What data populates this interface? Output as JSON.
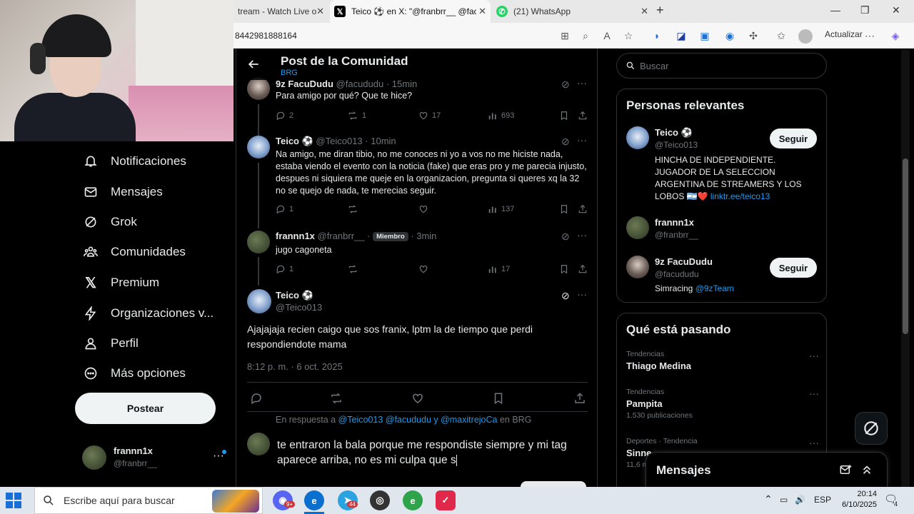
{
  "browser": {
    "tabs": [
      {
        "label": "tream - Watch Live o",
        "active": false
      },
      {
        "label": "Teico ⚽ en X: \"@franbrr__ @facu",
        "active": true
      },
      {
        "label": "(21) WhatsApp",
        "active": false
      }
    ],
    "new_tab": "+",
    "url": "8442981888164",
    "update_label": "Actualizar"
  },
  "nav": {
    "items": [
      {
        "label": "Notificaciones",
        "icon": "bell-icon"
      },
      {
        "label": "Mensajes",
        "icon": "mail-icon"
      },
      {
        "label": "Grok",
        "icon": "grok-icon"
      },
      {
        "label": "Comunidades",
        "icon": "communities-icon"
      },
      {
        "label": "Premium",
        "icon": "x-logo-icon"
      },
      {
        "label": "Organizaciones v...",
        "icon": "lightning-icon"
      },
      {
        "label": "Perfil",
        "icon": "person-icon"
      },
      {
        "label": "Más opciones",
        "icon": "more-circle-icon"
      }
    ],
    "post_button": "Postear",
    "me": {
      "name": "frannn1x",
      "handle": "@franbrr__"
    }
  },
  "main": {
    "title": "Post de la Comunidad",
    "subtitle": "BRG",
    "replies": [
      {
        "name": "9z FacuDudu",
        "handle": "@facududu",
        "time": "· 15min",
        "text": "Para amigo por qué? Que te hice?",
        "replies": "2",
        "reposts": "1",
        "likes": "17",
        "views": "693"
      },
      {
        "name": "Teico ⚽",
        "handle": "@Teico013",
        "time": "· 10min",
        "text": "Na amigo, me diran tibio, no me conoces ni yo a vos no me hiciste nada, estaba viendo el evento con la noticia (fake) que eras pro y me parecia injusto, despues ni siquiera me queje en la organizacion, pregunta si queres xq la 32 no se quejo de nada, te merecias seguir.",
        "replies": "1",
        "reposts": "",
        "likes": "",
        "views": "137"
      },
      {
        "name": "frannn1x",
        "handle": "@franbrr__",
        "badge": "Miembro",
        "time": "· 3min",
        "text": "jugo cagoneta",
        "replies": "1",
        "reposts": "",
        "likes": "",
        "views": "17"
      }
    ],
    "focused": {
      "name": "Teico ⚽",
      "handle": "@Teico013",
      "text": "Ajajajaja recien caigo que sos franix, lptm la de tiempo que perdi respondiendote mama",
      "timestamp": "8:12 p. m. · 6 oct. 2025"
    },
    "reply_context": {
      "prefix": "En respuesta a",
      "mentions": "@Teico013 @facududu y @maxitrejoCa",
      "suffix": "en BRG"
    },
    "composer_text": "te entraron la bala porque me respondiste siempre y mi tag aparece arriba, no es mi culpa que s"
  },
  "right": {
    "search_placeholder": "Buscar",
    "relevant": {
      "title": "Personas relevantes",
      "people": [
        {
          "name": "Teico ⚽",
          "handle": "@Teico013",
          "bio": "HINCHA DE INDEPENDIENTE. JUGADOR DE LA SELECCION ARGENTINA DE STREAMERS Y LOS LOBOS 🇦🇷❤️",
          "bio_link": "linktr.ee/teico13",
          "button": "Seguir"
        },
        {
          "name": "frannn1x",
          "handle": "@franbrr__"
        },
        {
          "name": "9z FacuDudu",
          "handle": "@facududu",
          "bio": "Simracing",
          "bio_link": "@9zTeam",
          "button": "Seguir"
        }
      ]
    },
    "trends": {
      "title": "Qué está pasando",
      "items": [
        {
          "meta": "Tendencias",
          "name": "Thiago Medina",
          "count": ""
        },
        {
          "meta": "Tendencias",
          "name": "Pampita",
          "count": "1.530 publicaciones"
        },
        {
          "meta": "Deportes · Tendencia",
          "name": "Sinne",
          "count": "11,6 m"
        }
      ]
    },
    "messages_drawer": "Mensajes"
  },
  "taskbar": {
    "search_placeholder": "Escribe aquí para buscar",
    "lang": "ESP",
    "time": "20:14",
    "date": "6/10/2025",
    "notif_count": "4",
    "discord_badge": "9+",
    "telegram_badge": "44"
  },
  "colors": {
    "accent": "#1d9bf0",
    "bg": "#000000",
    "muted": "#71767b"
  }
}
